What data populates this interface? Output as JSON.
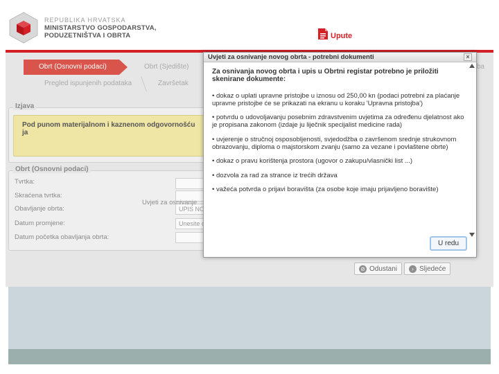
{
  "header": {
    "logo_line1": "REPUBLIKA HRVATSKA",
    "logo_line2": "MINISTARSTVO GOSPODARSTVA,",
    "logo_line3": "PODUZETNIŠTVA I OBRTA",
    "upute_label": "Upute",
    "logo_color": "#d42027",
    "accent_color": "#d42027"
  },
  "wizard": {
    "steps": [
      {
        "label": "Obrt (Osnovni podaci)",
        "active": true
      },
      {
        "label": "Obrt (Sjedište)",
        "active": false
      },
      {
        "label": "Pregled ispunjenih podataka",
        "active": false
      },
      {
        "label": "Završetak",
        "active": false
      }
    ],
    "partial_right_label": "ba"
  },
  "izjava": {
    "title": "Izjava",
    "text": "Pod punom materijalnom i kaznenom odgovornošću ja"
  },
  "obrt": {
    "title": "Obrt (Osnovni podaci)",
    "fields": [
      {
        "label": "Tvrtka:",
        "value": ""
      },
      {
        "label": "Skraćena tvrtka:",
        "value": ""
      },
      {
        "label": "Obavljanje obrta:",
        "value": "UPIS NO"
      },
      {
        "label": "Datum promjene:",
        "value": "Unesite d"
      },
      {
        "label": "Datum početka obavljanja obrta:",
        "value": ""
      }
    ],
    "footer_link": "Uvjeti za osnivanje"
  },
  "buttons": {
    "cancel": "Odustani",
    "next": "Sljedeće"
  },
  "modal": {
    "title": "Uvjeti za osnivanje novog obrta - potrebni dokumenti",
    "close": "×",
    "lead": "Za osnivanja novog obrta i upis u Obrtni registar potrebno je priložiti skenirane dokumente:",
    "items": [
      "• dokaz o uplati upravne pristojbe u iznosu od 250,00 kn (podaci potrebni za plaćanje upravne pristojbe će se prikazati na ekranu u koraku 'Upravna pristojba')",
      "• potvrdu o udovoljavanju posebnim zdravstvenim uvjetima za određenu djelatnost ako je propisana zakonom (izdaje ju liječnik specijalist medicine rada)",
      "• uvjerenje o stručnoj osposobljenosti, svjedodžba o završenom srednje strukovnom obrazovanju, diploma o majstorskom zvanju (samo za vezane i povlaštene obrte)",
      "• dokaz o pravu korištenja prostora (ugovor o zakupu/vlasnički list ...)",
      "• dozvola za rad za strance iz trećih država",
      "• važeća potvrda o prijavi boravišta (za osobe koje imaju prijavljeno boravište)"
    ],
    "ok_label": "U redu"
  }
}
